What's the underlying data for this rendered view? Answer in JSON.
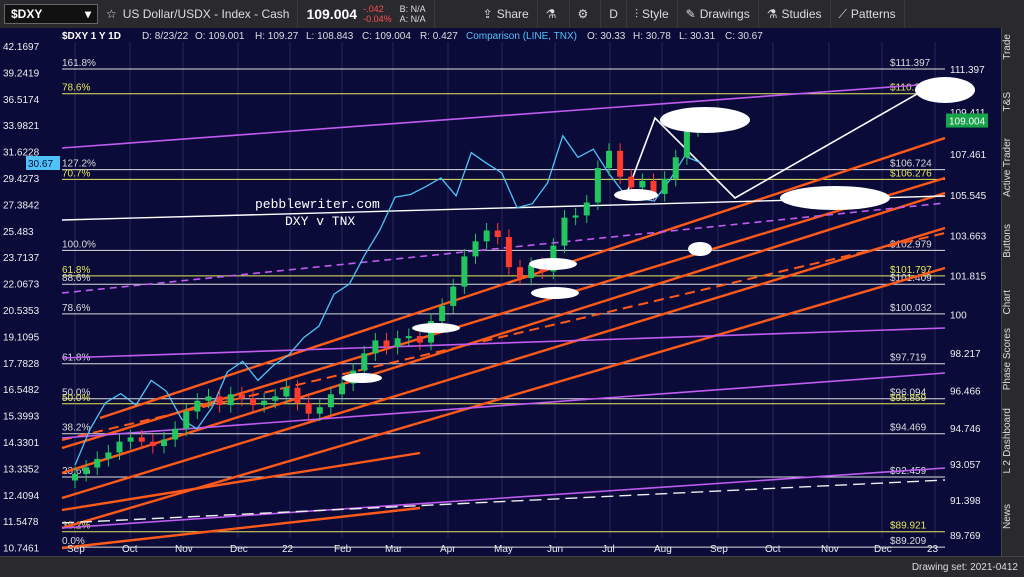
{
  "toolbar": {
    "symbol": "$DXY",
    "description": "US Dollar/USDX - Index - Cash",
    "last": "109.004",
    "change": "-.042",
    "change_pct": "-0.04%",
    "bid_label": "B: N/A",
    "ask_label": "A: N/A",
    "share": "Share",
    "period": "D",
    "style": "Style",
    "drawings": "Drawings",
    "studies": "Studies",
    "patterns": "Patterns"
  },
  "header": {
    "line1": "$DXY 1 Y 1D",
    "date": "D: 8/23/22",
    "open": "O: 109.001",
    "high": "H: 109.27",
    "low": "L: 108.843",
    "close": "C: 109.004",
    "range": "R: 0.427",
    "comparison": "Comparison (LINE, TNX)",
    "c_open": "O: 30.33",
    "c_high": "H: 30.78",
    "c_low": "L: 30.31",
    "c_close": "C: 30.67"
  },
  "annotation": {
    "line1": "pebblewriter.com",
    "line2": "DXY v TNX"
  },
  "side_tabs": [
    "Trade",
    "T&S",
    "Active Trader",
    "Buttons",
    "Chart",
    "Phase Scores",
    "Dashboard",
    "L 2",
    "News"
  ],
  "status": {
    "drawing_set": "Drawing set: 2021-0412"
  },
  "chart_data": {
    "type": "line",
    "x_labels": [
      "Sep",
      "Oct",
      "Nov",
      "Dec",
      "22",
      "Feb",
      "Mar",
      "Apr",
      "May",
      "Jun",
      "Jul",
      "Aug",
      "Sep",
      "Oct",
      "Nov",
      "Dec",
      "23"
    ],
    "left_axis_ticks": [
      "42.1697",
      "39.2419",
      "36.5174",
      "33.9821",
      "31.6228",
      "29.4273",
      "27.3842",
      "25.483",
      "23.7137",
      "22.0673",
      "20.5353",
      "19.1095",
      "17.7828",
      "16.5482",
      "15.3993",
      "14.3301",
      "13.3352",
      "12.4094",
      "11.5478",
      "10.7461"
    ],
    "right_axis_ticks": [
      "111.397",
      "109.411",
      "107.461",
      "105.545",
      "103.663",
      "101.815",
      "100",
      "98.217",
      "96.466",
      "94.746",
      "93.057",
      "91.398",
      "89.769"
    ],
    "last_price_label": "109.004",
    "tnx_last_label": "30.67",
    "fib_levels": [
      {
        "label": "161.8%",
        "price": "$111.397"
      },
      {
        "label": "78.6%",
        "price": "$110.251"
      },
      {
        "label": "127.2%",
        "price": "$106.724"
      },
      {
        "label": "70.7%",
        "price": "$106.276"
      },
      {
        "label": "100.0%",
        "price": "$102.979"
      },
      {
        "label": "61.8%",
        "price": "$101.797"
      },
      {
        "label": "88.6%",
        "price": "$101.409"
      },
      {
        "label": "78.6%",
        "price": "$100.032"
      },
      {
        "label": "61.8%",
        "price": "$97.719"
      },
      {
        "label": "50.0%",
        "price": "$96.094"
      },
      {
        "label": "50.0%",
        "price": "$95.859"
      },
      {
        "label": "38.2%",
        "price": "$94.469"
      },
      {
        "label": "23.6%",
        "price": "$92.459"
      },
      {
        "label": "38.2%",
        "price": "$89.921"
      },
      {
        "label": "0.0%",
        "price": "$89.209"
      }
    ],
    "dxy_close_approx": [
      92.6,
      92.9,
      93.3,
      93.6,
      94.1,
      94.3,
      94.1,
      93.9,
      94.2,
      94.7,
      95.5,
      96.0,
      96.2,
      95.8,
      96.3,
      96.1,
      95.8,
      96.0,
      96.2,
      96.6,
      95.9,
      95.4,
      95.7,
      96.3,
      96.8,
      97.4,
      98.2,
      98.8,
      98.5,
      98.9,
      99.0,
      98.7,
      99.7,
      100.4,
      101.3,
      102.7,
      103.4,
      103.9,
      103.6,
      102.2,
      101.7,
      102.3,
      102.0,
      103.2,
      104.5,
      104.6,
      105.2,
      106.8,
      107.6,
      106.4,
      105.9,
      106.2,
      105.6,
      106.3,
      107.3,
      108.6,
      109.0
    ],
    "tnx_close_approx": [
      13.4,
      14.8,
      15.9,
      16.3,
      15.8,
      16.9,
      16.4,
      15.2,
      14.8,
      15.7,
      17.3,
      17.8,
      16.9,
      17.6,
      18.1,
      19.0,
      19.6,
      21.4,
      22.0,
      23.8,
      25.5,
      27.9,
      28.1,
      28.7,
      29.4,
      28.0,
      31.5,
      30.6,
      29.8,
      27.1,
      27.4,
      29.0,
      33.0,
      31.1,
      31.8,
      29.8,
      28.2,
      27.8,
      27.6,
      29.2,
      31.2,
      30.67
    ]
  }
}
